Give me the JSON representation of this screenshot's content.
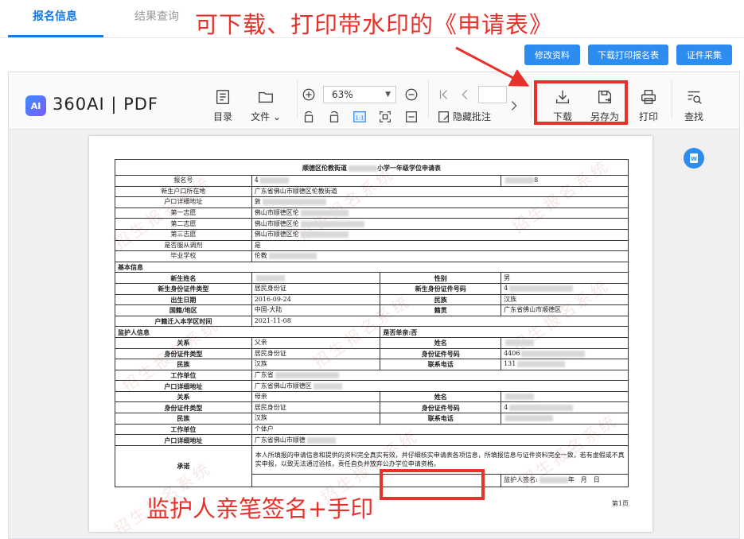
{
  "tabs": [
    {
      "label": "报名信息",
      "active": true
    },
    {
      "label": "结果查询",
      "active": false
    }
  ],
  "annotations": {
    "top": "可下载、打印带水印的《申请表》",
    "bottom": "监护人亲笔签名+手印",
    "color": "#e8312a"
  },
  "actions": {
    "modify": "修改资料",
    "download_print": "下载打印报名表",
    "id_capture": "证件采集",
    "color": "#2d8cf0"
  },
  "viewer": {
    "logo_ai": "AI",
    "logo_text": "360AI | PDF",
    "toolbar": {
      "toc": "目录",
      "file": "文件 ⌄",
      "zoom": "63%",
      "hide_annotations": "隐藏批注",
      "download": "下载",
      "save_as": "另存为",
      "print": "打印",
      "find": "查找"
    }
  },
  "document": {
    "title": "顺德区伦教街道",
    "title_tail": "小学一年级学位申请表",
    "rows_top": [
      {
        "label": "报名号",
        "value": "4",
        "right": "8"
      },
      {
        "label": "新生户口所在地",
        "value": "广东省佛山市顺德区伦教街道"
      },
      {
        "label": "户口详细地址",
        "value": "敦"
      },
      {
        "label": "第一志愿",
        "value": "佛山市顺德区伦"
      },
      {
        "label": "第二志愿",
        "value": "佛山市顺德区伦"
      },
      {
        "label": "第三志愿",
        "value": "佛山市顺德区伦"
      },
      {
        "label": "是否服从调剂",
        "value": "是"
      },
      {
        "label": "毕业学校",
        "value": "伦教"
      }
    ],
    "section_basic": "基本信息",
    "basic": {
      "name_label": "新生姓名",
      "gender_label": "性别",
      "gender": "男",
      "idtype_label": "新生身份证件类型",
      "idtype": "居民身份证",
      "idno_label": "新生身份证件号码",
      "idno": "4",
      "birth_label": "出生日期",
      "birth": "2016-09-24",
      "ethnic_label": "民族",
      "ethnic": "汉族",
      "nation_label": "国籍/地区",
      "nation": "中国-大陆",
      "native_label": "籍贯",
      "native": "广东省佛山市顺德区",
      "move_label": "户籍迁入本学区时间",
      "move": "2021-11-08"
    },
    "section_guardian": "监护人信息",
    "single_parent": "是否单亲:否",
    "guardians": [
      {
        "relation_label": "关系",
        "relation": "父亲",
        "name_label": "姓名",
        "name": "",
        "idtype_label": "身份证件类型",
        "idtype": "居民身份证",
        "idno_label": "身份证件号码",
        "idno": "4406",
        "ethnic_label": "民族",
        "ethnic": "汉族",
        "phone_label": "联系电话",
        "phone": "131",
        "work_label": "工作单位",
        "work": "广东省",
        "addr_label": "户口详细地址",
        "addr": "广东省佛山市顺德区"
      },
      {
        "relation_label": "关系",
        "relation": "母亲",
        "name_label": "姓名",
        "name": "",
        "idtype_label": "身份证件类型",
        "idtype": "居民身份证",
        "idno_label": "身份证件号码",
        "idno": "4",
        "ethnic_label": "民族",
        "ethnic": "汉族",
        "phone_label": "联系电话",
        "phone": "",
        "work_label": "工作单位",
        "work": "个体户",
        "addr_label": "户口详细地址",
        "addr": "广东省佛山市顺德"
      }
    ],
    "promise_label": "承诺",
    "promise_text": "本人所填报的申请信息和提供的资料完全真实有效，并仔细核实申请表各项信息，所填报信息与证件资料完全一致，若有虚假或不真实申报，以致无法通过验核，责任自负并放弃公办学位申请资格。",
    "signature_label": "监护人签名:",
    "date_label": "年　月　日",
    "page_number": "第1页",
    "watermark": "招生报名系统"
  }
}
